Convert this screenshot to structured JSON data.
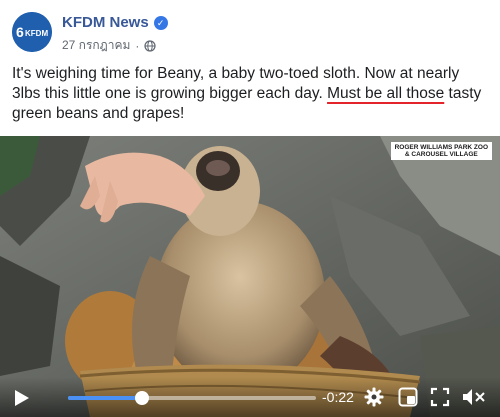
{
  "post": {
    "page_name": "KFDM News",
    "avatar_text": "KFDM",
    "avatar_number": "6",
    "date": "27 กรกฎาคม",
    "separator": "·",
    "text_before": "It's weighing time for Beany, a baby two-toed sloth. Now at nearly 3lbs this little one is growing bigger each day. ",
    "text_underlined": "Must be all those",
    "text_after": " tasty green beans and grapes!"
  },
  "video": {
    "watermark_line1": "ROGER WILLIAMS PARK ZOO",
    "watermark_line2": "& CAROUSEL VILLAGE",
    "time_remaining": "-0:22",
    "progress": 0.3
  },
  "colors": {
    "brand": "#385898",
    "underline": "#e3242b",
    "progress": "#4b90f5",
    "verified": "#3578e5"
  },
  "icons": [
    "verified-icon",
    "globe-icon",
    "play-icon",
    "gear-icon",
    "pip-icon",
    "fullscreen-icon",
    "volume-icon"
  ]
}
